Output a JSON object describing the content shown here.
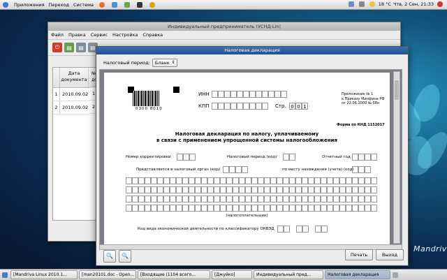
{
  "top_panel": {
    "menus": [
      "Приложения",
      "Переход",
      "Система"
    ],
    "temperature": "18 °C",
    "datetime": "Чтв, 2 Сен, 21:33"
  },
  "main_window": {
    "title": "Индивидуальный предприниматель (УСНД-Lin)",
    "menu": [
      "Файл",
      "Правка",
      "Сервис",
      "Настройка",
      "Справка"
    ],
    "table": {
      "col_header_line1": "Дата",
      "col_header_line2": "документа",
      "col2_header": "№ до",
      "rows": [
        {
          "n": "1",
          "date": "2010.09.02",
          "num": "1"
        },
        {
          "n": "2",
          "date": "2010.09.02",
          "num": "2"
        }
      ]
    }
  },
  "dialog": {
    "title": "Налоговая декларация",
    "period_label": "Налоговый период:",
    "period_value": "Бланк",
    "print_button": "Печать",
    "exit_button": "Выход",
    "form": {
      "barcode": "0300 8010",
      "inn_label": "ИНН",
      "kpp_label": "КПП",
      "page_label": "Стр.",
      "page_digits": [
        "0",
        "0",
        "1"
      ],
      "appendix_line1": "Приложение № 1",
      "appendix_line2": "к Приказу Минфина РФ",
      "appendix_line3": "от 22.06.2009 № 58н",
      "knd": "Форма по КНД 1152017",
      "heading_line1": "Налоговая декларация по налогу, уплачиваемому",
      "heading_line2": "в связи с применением упрощенной системы налогообложения",
      "correction_label": "Номер корректировки",
      "period_code_label": "Налоговый период (код)",
      "year_label": "Отчетный год",
      "authority_label": "Представляется в налоговый орган (код)",
      "location_label": "по месту нахождения (учета) (код)",
      "taxpayer_label": "(налогоплательщик)",
      "okved_label": "Код вида экономической деятельности по классификатору ОКВЭД"
    }
  },
  "taskbar": {
    "items": [
      {
        "label": "[Mandriva Linux 2010.1...",
        "active": false
      },
      {
        "label": "[man20101.doc - Open...",
        "active": false
      },
      {
        "label": "[Входящие (1104 всего...",
        "active": false
      },
      {
        "label": "[Джуйко]",
        "active": false
      },
      {
        "label": "Индивидуальный пред...",
        "active": false
      },
      {
        "label": "Налоговая декларация",
        "active": true
      }
    ]
  },
  "brand": "Mandriva"
}
